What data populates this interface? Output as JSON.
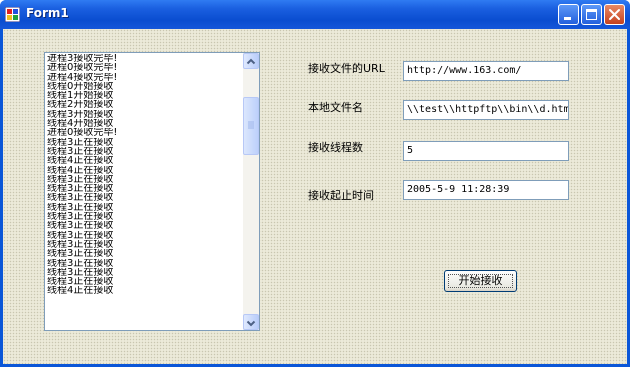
{
  "window": {
    "title": "Form1"
  },
  "icons": {
    "app": "app-icon",
    "minimize": "minimize-icon",
    "maximize": "maximize-icon",
    "close": "close-icon"
  },
  "log_list": {
    "items": [
      "进程3接收完毕!",
      "进程0接收完毕!",
      "进程4接收完毕!",
      "线程0开始接收",
      "线程1开始接收",
      "线程2开始接收",
      "线程3开始接收",
      "线程4开始接收",
      "进程0接收完毕!",
      "线程3正在接收",
      "线程3正在接收",
      "线程4正在接收",
      "线程4正在接收",
      "线程3正在接收",
      "线程3正在接收",
      "线程3正在接收",
      "线程3正在接收",
      "线程3正在接收",
      "线程3正在接收",
      "线程3正在接收",
      "线程3正在接收",
      "线程3正在接收",
      "线程3正在接收",
      "线程3正在接收",
      "线程3正在接收",
      "线程4正在接收"
    ]
  },
  "form": {
    "url_label": "接收文件的URL",
    "url_value": "http://www.163.com/",
    "local_label": "本地文件名",
    "local_value": "\\\\test\\\\httpftp\\\\bin\\\\d.htm",
    "threads_label": "接收线程数",
    "threads_value": "5",
    "time_label": "接收起止时间",
    "time_value": "2005-5-9 11:28:39",
    "start_button": "开始接收"
  }
}
